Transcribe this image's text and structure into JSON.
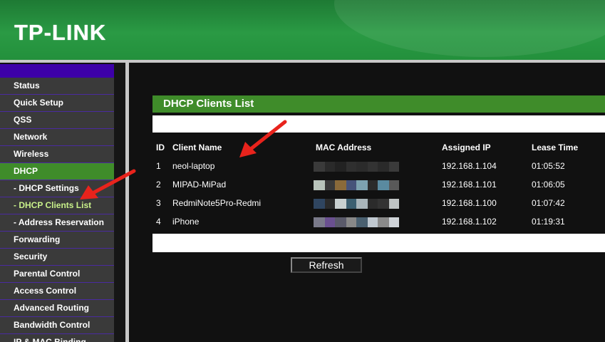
{
  "brand": {
    "logo": "TP-LINK"
  },
  "sidebar": {
    "items": [
      {
        "label": "Status",
        "state": "normal"
      },
      {
        "label": "Quick Setup",
        "state": "normal"
      },
      {
        "label": "QSS",
        "state": "normal"
      },
      {
        "label": "Network",
        "state": "normal"
      },
      {
        "label": "Wireless",
        "state": "normal"
      },
      {
        "label": "DHCP",
        "state": "active"
      },
      {
        "label": "- DHCP Settings",
        "state": "normal"
      },
      {
        "label": "- DHCP Clients List",
        "state": "selected"
      },
      {
        "label": "- Address Reservation",
        "state": "normal"
      },
      {
        "label": "Forwarding",
        "state": "normal"
      },
      {
        "label": "Security",
        "state": "normal"
      },
      {
        "label": "Parental Control",
        "state": "normal"
      },
      {
        "label": "Access Control",
        "state": "normal"
      },
      {
        "label": "Advanced Routing",
        "state": "normal"
      },
      {
        "label": "Bandwidth Control",
        "state": "normal"
      },
      {
        "label": "IP & MAC Binding",
        "state": "normal"
      }
    ]
  },
  "main": {
    "title": "DHCP Clients List",
    "table": {
      "headers": {
        "id": "ID",
        "name": "Client Name",
        "mac": "MAC Address",
        "ip": "Assigned IP",
        "lease": "Lease Time"
      },
      "rows": [
        {
          "id": "1",
          "name": "neol-laptop",
          "mac_colors": [
            "#3a3a3a",
            "#2a2a2a",
            "#222",
            "#2f2f2f",
            "#2b2b2b",
            "#333",
            "#2a2a2a",
            "#3a3a3a"
          ],
          "ip": "192.168.1.104",
          "lease": "01:05:52"
        },
        {
          "id": "2",
          "name": "MIPAD-MiPad",
          "mac_colors": [
            "#b9c4bb",
            "#3a3a3a",
            "#8a6a3a",
            "#46537a",
            "#7da2b0",
            "#2b2b2b",
            "#5a8aa0",
            "#595959"
          ],
          "ip": "192.168.1.101",
          "lease": "01:06:05"
        },
        {
          "id": "3",
          "name": "RedmiNote5Pro-Redmi",
          "mac_colors": [
            "#2f4560",
            "#2a2a2a",
            "#c8d0d0",
            "#3c5f70",
            "#a9b5ba",
            "#2b2b2b",
            "#333",
            "#bfc4c4"
          ],
          "ip": "192.168.1.100",
          "lease": "01:07:42"
        },
        {
          "id": "4",
          "name": "iPhone",
          "mac_colors": [
            "#7a7a8a",
            "#6a5090",
            "#5a5a6a",
            "#888",
            "#4a6070",
            "#c0c8d0",
            "#8a8a8a",
            "#d0d4d8"
          ],
          "ip": "192.168.1.102",
          "lease": "01:19:31"
        }
      ]
    },
    "refresh_label": "Refresh"
  },
  "colors": {
    "brand_green": "#2a9a44",
    "menu_active": "#3f8c2a",
    "annotation_red": "#e8231c"
  }
}
